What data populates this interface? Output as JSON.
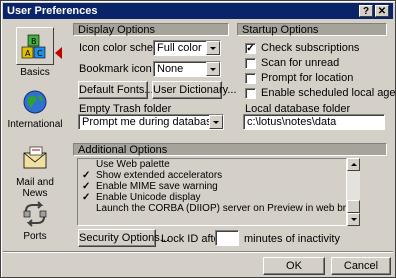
{
  "window": {
    "title": "User Preferences",
    "help_btn": "?",
    "close_btn": "✕"
  },
  "sidebar": {
    "items": [
      {
        "label": "Basics",
        "icon": "blocks-icon"
      },
      {
        "label": "International",
        "icon": "globe-icon"
      },
      {
        "label": "Mail and News",
        "icon": "envelope-icon"
      },
      {
        "label": "Ports",
        "icon": "ports-icon"
      }
    ]
  },
  "display": {
    "header": "Display Options",
    "icon_scheme_label": "Icon color scheme",
    "icon_scheme_value": "Full color",
    "bookmark_label": "Bookmark icon size",
    "bookmark_value": "None",
    "default_fonts_btn": "Default Fonts...",
    "user_dict_btn": "User Dictionary...",
    "empty_trash_label": "Empty Trash folder",
    "empty_trash_value": "Prompt me during database close"
  },
  "startup": {
    "header": "Startup Options",
    "options": [
      {
        "label": "Check subscriptions",
        "checked": true
      },
      {
        "label": "Scan for unread",
        "checked": false
      },
      {
        "label": "Prompt for location",
        "checked": false
      },
      {
        "label": "Enable scheduled local agents",
        "checked": false
      }
    ],
    "local_db_label": "Local database folder",
    "local_db_value": "c:\\lotus\\notes\\data"
  },
  "additional": {
    "header": "Additional Options",
    "items": [
      {
        "label": "Use Web palette",
        "checked": false
      },
      {
        "label": "Show extended accelerators",
        "checked": true
      },
      {
        "label": "Enable MIME save warning",
        "checked": true
      },
      {
        "label": "Enable Unicode display",
        "checked": true
      },
      {
        "label": "Launch the CORBA (DIIOP) server on Preview in web browser",
        "checked": false
      },
      {
        "label": "",
        "checked": false
      }
    ],
    "check_mark": "✓"
  },
  "security": {
    "security_btn": "Security Options...",
    "lock_label": "Lock ID after",
    "lock_value": "",
    "minutes_label": "minutes of inactivity"
  },
  "footer": {
    "ok_btn": "OK",
    "cancel_btn": "Cancel"
  },
  "colors": {
    "titlebar": "#0a246a",
    "face": "#d4d0c8",
    "selection_arrow": "#c00000"
  }
}
